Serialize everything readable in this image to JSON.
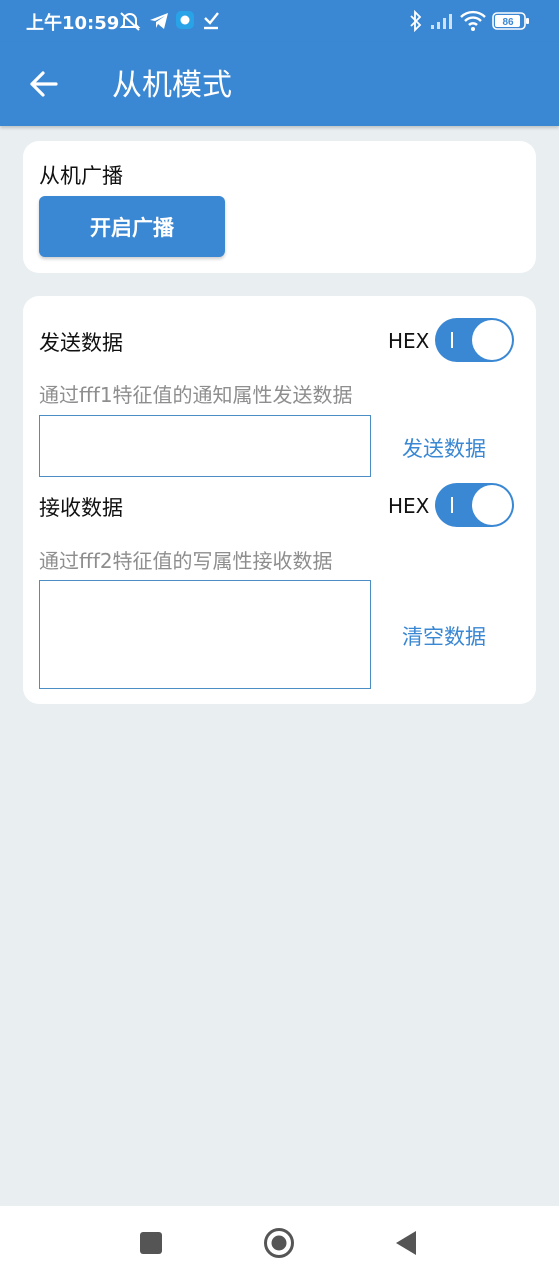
{
  "status_bar": {
    "time": "上午10:59",
    "battery": "86"
  },
  "app_bar": {
    "title": "从机模式"
  },
  "broadcast_card": {
    "title": "从机广播",
    "button_label": "开启广播"
  },
  "data_card": {
    "send": {
      "title": "发送数据",
      "hex_label": "HEX",
      "hex_enabled": true,
      "hint": "通过fff1特征值的通知属性发送数据",
      "input_value": "",
      "action_label": "发送数据"
    },
    "receive": {
      "title": "接收数据",
      "hex_label": "HEX",
      "hex_enabled": true,
      "hint": "通过fff2特征值的写属性接收数据",
      "output_value": "",
      "action_label": "清空数据"
    }
  },
  "colors": {
    "accent": "#3a87d3",
    "background": "#e9eef1",
    "card": "#ffffff",
    "hint_text": "#8e8e8e"
  },
  "icons": {
    "status": [
      "do-not-disturb-icon",
      "telegram-icon",
      "app-notification-icon",
      "download-done-icon",
      "bluetooth-icon",
      "signal-icon",
      "wifi-icon",
      "battery-icon"
    ],
    "app_bar": "back-arrow-icon",
    "nav": [
      "recent-apps-icon",
      "home-icon",
      "back-icon"
    ]
  }
}
